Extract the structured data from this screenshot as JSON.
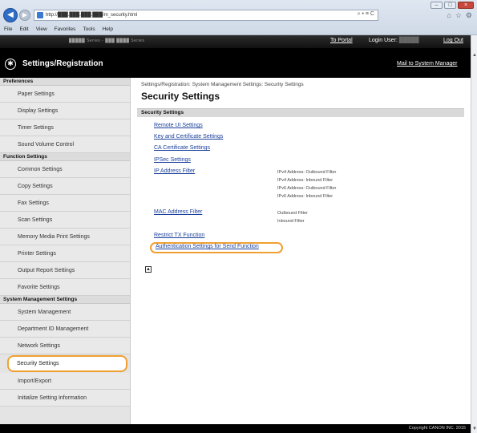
{
  "browser": {
    "address_url": "http://███.███.███.███/m_security.html",
    "search_icons": "⌕ • ≡ C",
    "tab_icons": [
      "⌂",
      "☆",
      "⚙"
    ],
    "menu": [
      "File",
      "Edit",
      "View",
      "Favorites",
      "Tools",
      "Help"
    ]
  },
  "header": {
    "device_name": "█████ Series - ███ ████ Series",
    "portal_link": "To Portal",
    "login_user_label": "Login User:",
    "login_user_name": "█████",
    "logout_link": "Log Out",
    "app_title": "Settings/Registration",
    "mail_link": "Mail to System Manager"
  },
  "sidebar": {
    "sections": [
      {
        "title": "Preferences",
        "items": [
          "Paper Settings",
          "Display Settings",
          "Timer Settings",
          "Sound Volume Control"
        ]
      },
      {
        "title": "Function Settings",
        "items": [
          "Common Settings",
          "Copy Settings",
          "Fax Settings",
          "Scan Settings",
          "Memory Media Print Settings",
          "Printer Settings",
          "Output Report Settings",
          "Favorite Settings"
        ]
      },
      {
        "title": "System Management Settings",
        "items": [
          "System Management",
          "Department ID Management",
          "Network Settings",
          "Security Settings",
          "Import/Export",
          "Initialize Setting Information"
        ]
      }
    ],
    "active_item": "Security Settings"
  },
  "main": {
    "breadcrumb": "Settings/Registration: System Management Settings: Security Settings",
    "page_title": "Security Settings",
    "section_title": "Security Settings",
    "links": {
      "remote_ui": "Remote UI Settings",
      "key_cert": "Key and Certificate Settings",
      "ca_cert": "CA Certificate Settings",
      "ipsec": "IPSec Settings",
      "ip_filter": "IP Address Filter",
      "mac_filter": "MAC Address Filter",
      "restrict_tx": "Restrict TX Function",
      "auth_send": "Authentication Settings for Send Function"
    },
    "ip_filter_desc": [
      "IPv4 Address: Outbound Filter",
      "IPv4 Address: Inbound Filter",
      "IPv6 Address: Outbound Filter",
      "IPv6 Address: Inbound Filter"
    ],
    "mac_filter_desc": [
      "Outbound Filter",
      "Inbound Filter"
    ],
    "top_icon": "▲"
  },
  "footer": {
    "copyright": "Copyright CANON INC. 2015"
  },
  "colors": {
    "highlight": "#f0a032",
    "link": "#1a3f9a",
    "header_bg": "#000000",
    "sidebar_bg": "#e4e4e4"
  }
}
